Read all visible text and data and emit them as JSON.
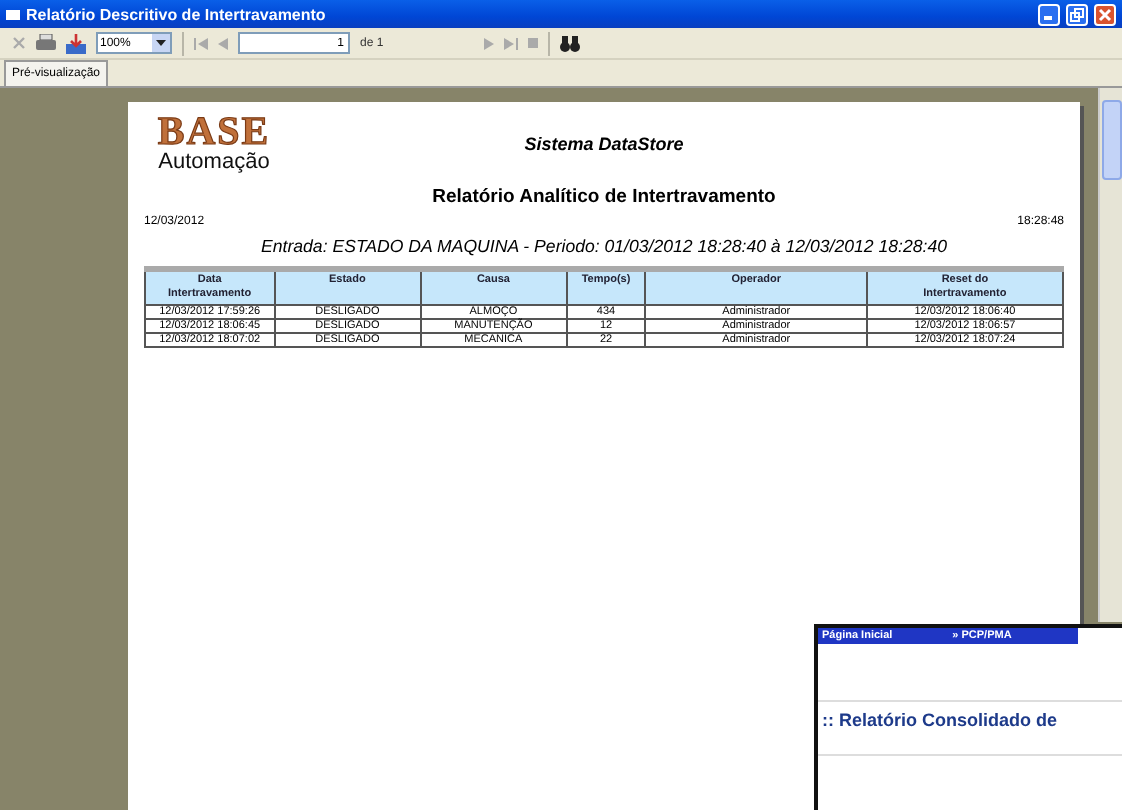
{
  "window": {
    "title": "Relatório Descritivo de Intertravamento"
  },
  "toolbar": {
    "zoom": "100%",
    "page": "1",
    "page_of": "de 1"
  },
  "tabs": [
    {
      "label": "Pré-visualização",
      "selected": true
    }
  ],
  "report": {
    "logo_top": "BASE",
    "logo_bottom": "Automação",
    "system": "Sistema DataStore",
    "title": "Relatório Analítico de Intertravamento",
    "date": "12/03/2012",
    "time": "18:28:48",
    "filter": "Entrada: ESTADO DA MAQUINA - Periodo: 01/03/2012 18:28:40 à 12/03/2012 18:28:40",
    "columns": [
      "Data Intertravamento",
      "Estado",
      "Causa",
      "Tempo(s)",
      "Operador",
      "Reset do Intertravamento"
    ],
    "rows": [
      [
        "12/03/2012  17:59:26",
        "DESLIGADO",
        "ALMOÇO",
        "434",
        "Administrador",
        "12/03/2012  18:06:40"
      ],
      [
        "12/03/2012  18:06:45",
        "DESLIGADO",
        "MANUTENÇÃO",
        "12",
        "Administrador",
        "12/03/2012  18:06:57"
      ],
      [
        "12/03/2012  18:07:02",
        "DESLIGADO",
        "MECANICA",
        "22",
        "Administrador",
        "12/03/2012  18:07:24"
      ]
    ]
  },
  "overlay_window": {
    "breadcrumb": [
      "Página Inicial",
      "» PCP/PMA"
    ],
    "heading": ":: Relatório Consolidado de"
  }
}
